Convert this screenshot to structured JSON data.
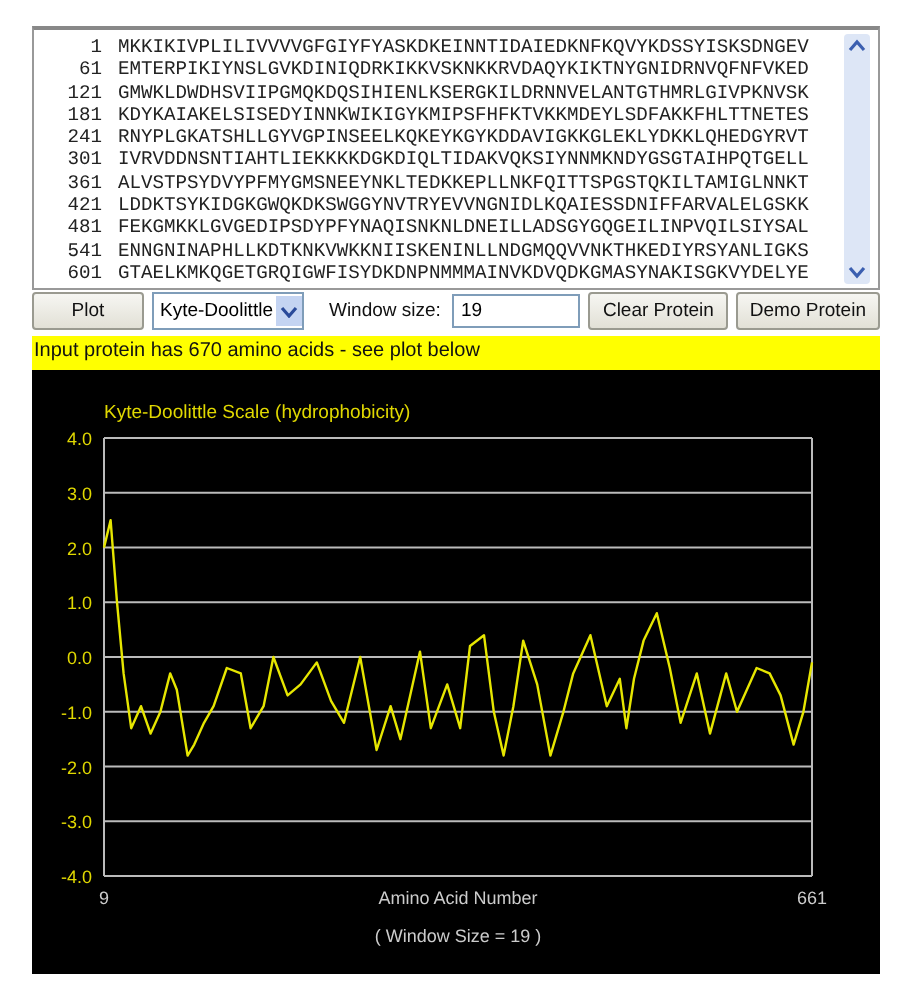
{
  "sequence": {
    "lines": [
      {
        "number": "1",
        "residues": "MKKIKIVPLILIVVVVGFGIYFYASKDKEINNTIDAIEDKNFKQVYKDSSYISKSDNGEV"
      },
      {
        "number": "61",
        "residues": "EMTERPIKIYNSLGVKDINIQDRKIKKVSKNKKRVDAQYKIKTNYGNIDRNVQFNFVKED"
      },
      {
        "number": "121",
        "residues": "GMWKLDWDHSVIIPGMQKDQSIHIENLKSERGKILDRNNVELANTGTHMRLGIVPKNVSK"
      },
      {
        "number": "181",
        "residues": "KDYKAIAKELSISEDYINNKWIKIGYKMIPSFHFKTVKKMDEYLSDFAKKFHLTTNETES"
      },
      {
        "number": "241",
        "residues": "RNYPLGKATSHLLGYVGPINSEELKQKEYKGYKDDAVIGKKGLEKLYDKKLQHEDGYRVT"
      },
      {
        "number": "301",
        "residues": "IVRVDDNSNTIAHTLIEKKKKDGKDIQLTIDAKVQKSIYNNMKNDYGSGTAIHPQTGELL"
      },
      {
        "number": "361",
        "residues": "ALVSTPSYDVYPFMYGMSNEEYNKLTEDKKEPLLNKFQITTSPGSTQKILTAMIGLNNKT"
      },
      {
        "number": "421",
        "residues": "LDDKTSYKIDGKGWQKDKSWGGYNVTRYEVVNGNIDLKQAIESSDNIFFARVALELGSKK"
      },
      {
        "number": "481",
        "residues": "FEKGMKKLGVGEDIPSDYPFYNAQISNKNLDNEILLADSGYGQGEILINPVQILSIYSAL"
      },
      {
        "number": "541",
        "residues": "ENNGNINAPHLLKDTKNKVWKKNIISKENINLLNDGMQQVVNKTHKEDIYRSYANLIGKS"
      },
      {
        "number": "601",
        "residues": "GTAELKMKQGETGRQIGWFISYDKDNPNMMMAINVKDVQDKGMASYNAKISGKVYDELYE"
      }
    ]
  },
  "controls": {
    "plot_button": "Plot",
    "scale": "Kyte-Doolittle",
    "window_label": "Window size:",
    "window_value": "19",
    "clear_button": "Clear Protein",
    "demo_button": "Demo Protein"
  },
  "status": "Input protein has 670 amino acids - see plot below",
  "plot": {
    "window_note": "( Window Size = 19 )",
    "chart_data": {
      "type": "line",
      "title": "Kyte-Doolittle Scale (hydrophobicity)",
      "xlabel": "Amino Acid Number",
      "x": [
        9,
        15,
        21,
        27,
        34,
        43,
        52,
        61,
        70,
        76,
        86,
        92,
        101,
        110,
        122,
        135,
        144,
        156,
        165,
        178,
        190,
        205,
        218,
        230,
        245,
        260,
        273,
        282,
        300,
        310,
        325,
        337,
        346,
        359,
        368,
        377,
        386,
        395,
        408,
        420,
        432,
        441,
        457,
        472,
        484,
        490,
        497,
        506,
        518,
        530,
        540,
        555,
        567,
        582,
        592,
        610,
        622,
        632,
        644,
        653,
        661
      ],
      "grid": true,
      "series": [
        {
          "color": "#e6e600",
          "values": [
            2.0,
            2.5,
            1.0,
            -0.3,
            -1.3,
            -0.9,
            -1.4,
            -1.0,
            -0.3,
            -0.6,
            -1.8,
            -1.6,
            -1.2,
            -0.9,
            -0.2,
            -0.3,
            -1.3,
            -0.9,
            0.0,
            -0.7,
            -0.5,
            -0.1,
            -0.8,
            -1.2,
            0.0,
            -1.7,
            -0.9,
            -1.5,
            0.1,
            -1.3,
            -0.5,
            -1.3,
            0.2,
            0.4,
            -1.0,
            -1.8,
            -0.9,
            0.3,
            -0.5,
            -1.8,
            -1.0,
            -0.3,
            0.4,
            -0.9,
            -0.4,
            -1.3,
            -0.4,
            0.3,
            0.8,
            -0.2,
            -1.2,
            -0.3,
            -1.4,
            -0.3,
            -1.0,
            -0.2,
            -0.3,
            -0.7,
            -1.6,
            -1.0,
            -0.1
          ]
        }
      ],
      "xlim": [
        9,
        661
      ],
      "ylim": [
        -4,
        4
      ],
      "xticks": [
        9,
        661
      ],
      "yticks": [
        {
          "value": 4,
          "label": "4.0"
        },
        {
          "value": 3,
          "label": "3.0"
        },
        {
          "value": 2,
          "label": "2.0"
        },
        {
          "value": 1,
          "label": "1.0"
        },
        {
          "value": 0,
          "label": "0.0"
        },
        {
          "value": -1,
          "label": "-1.0"
        },
        {
          "value": -2,
          "label": "-2.0"
        },
        {
          "value": -3,
          "label": "-3.0"
        },
        {
          "value": -4,
          "label": "-4.0"
        }
      ]
    }
  }
}
